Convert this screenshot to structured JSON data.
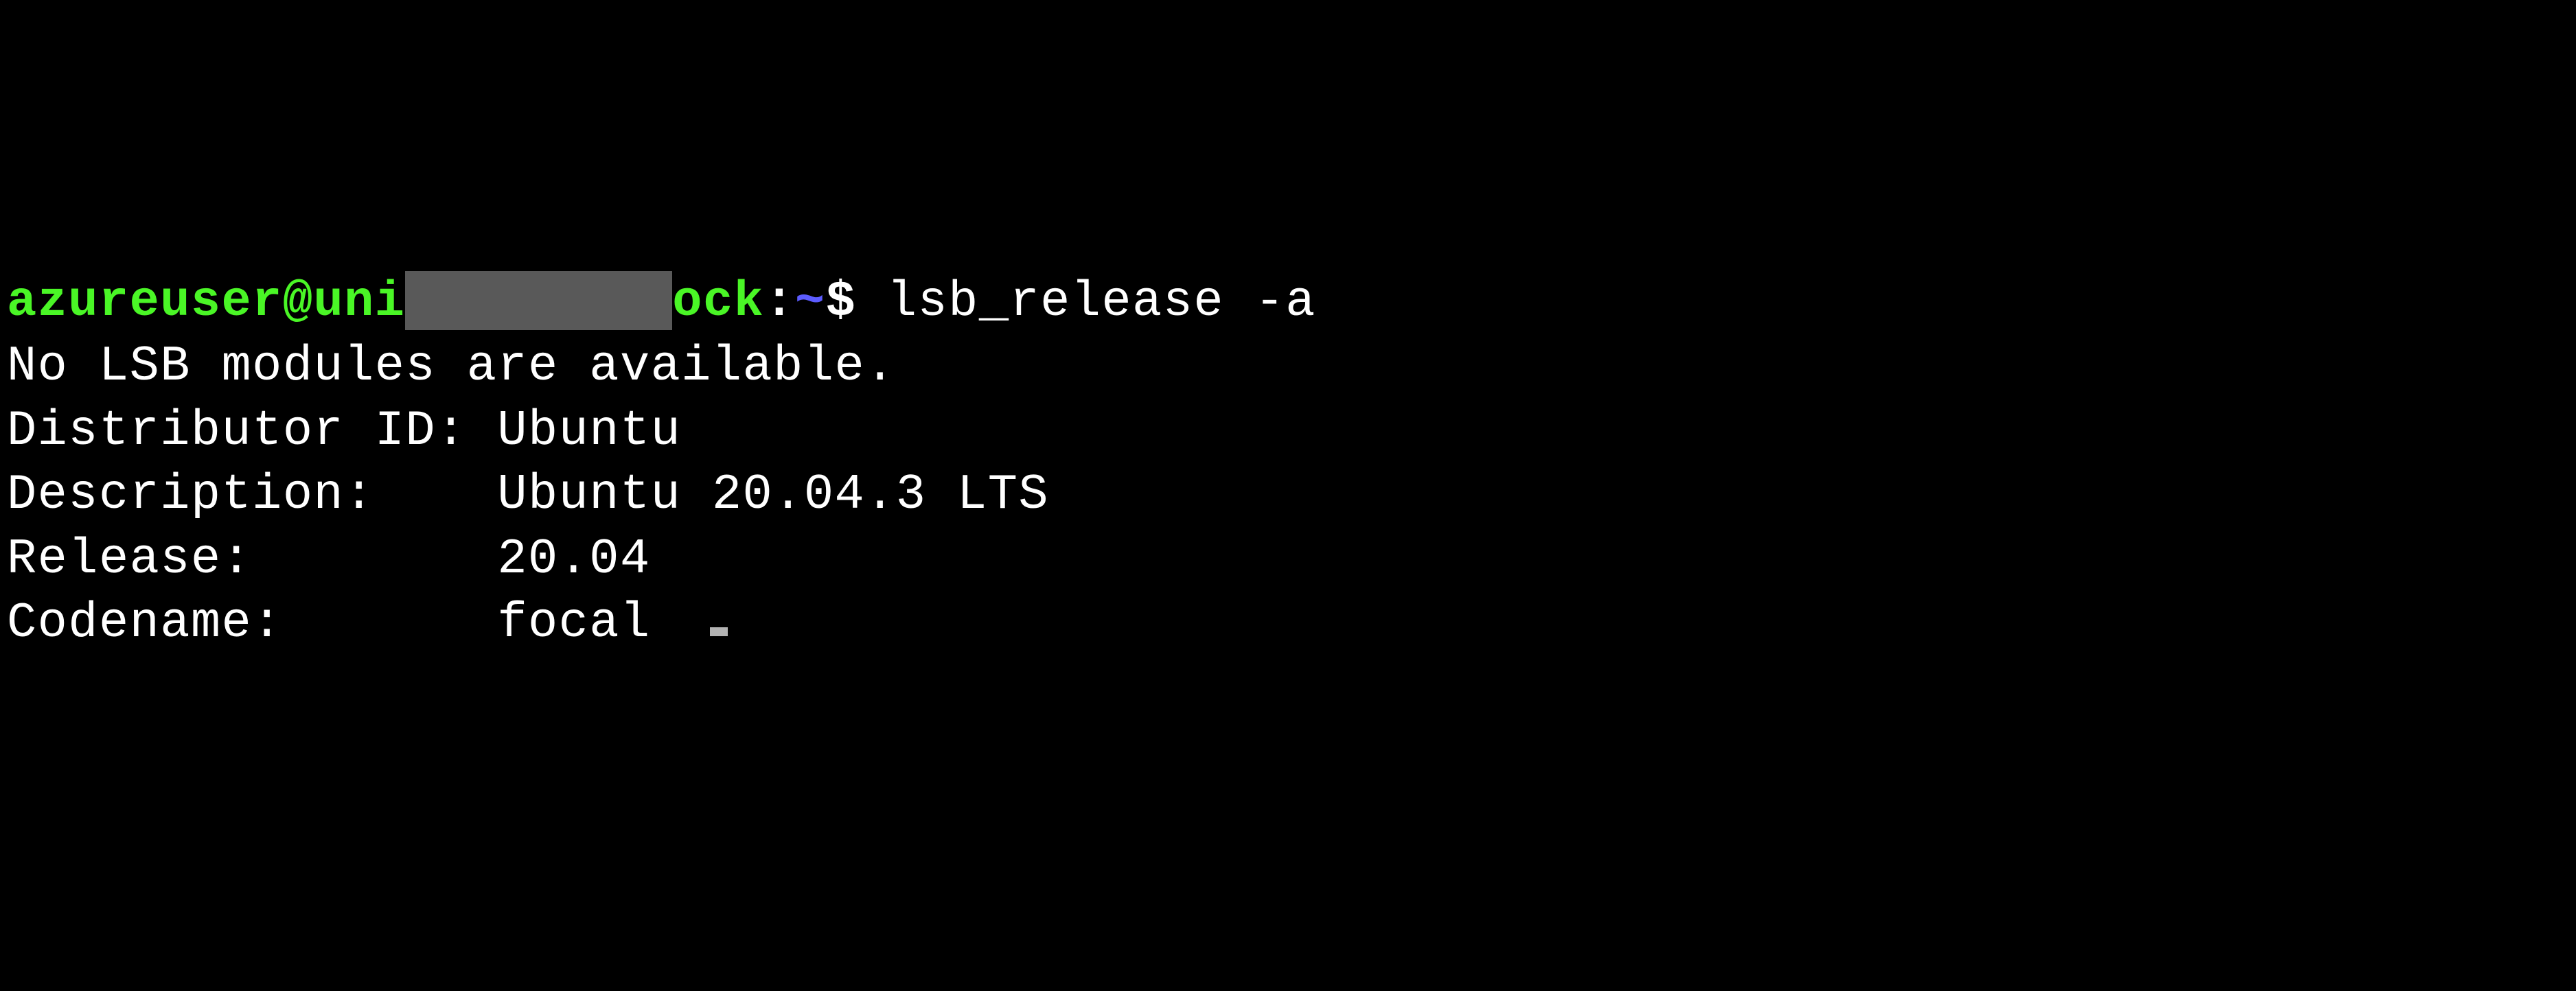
{
  "prompt": {
    "user": "azureuser",
    "at": "@",
    "host_prefix": "uni",
    "host_suffix": "ock",
    "separator": ":",
    "path": "~",
    "symbol": "$"
  },
  "command": "lsb_release -a",
  "output": {
    "line1": "No LSB modules are available.",
    "line2_label": "Distributor ID:",
    "line2_value": " Ubuntu",
    "line3_label": "Description:",
    "line3_value": "    Ubuntu 20.04.3 LTS",
    "line4_label": "Release:",
    "line4_value": "        20.04",
    "line5_label": "Codename:",
    "line5_value": "       focal"
  }
}
